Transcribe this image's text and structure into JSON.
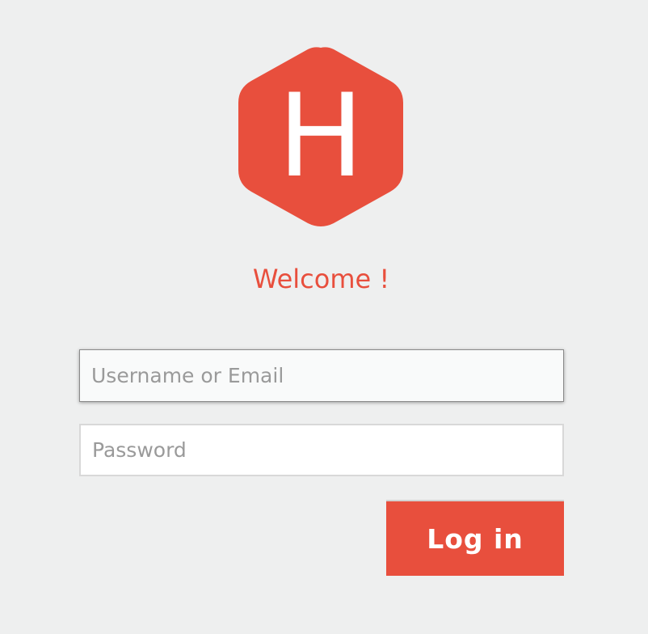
{
  "logo": {
    "letter": "H",
    "color": "#e84f3d"
  },
  "welcome_text": "Welcome !",
  "form": {
    "username_placeholder": "Username or Email",
    "username_value": "",
    "password_placeholder": "Password",
    "password_value": "",
    "login_label": "Log in"
  },
  "colors": {
    "accent": "#e84f3d",
    "background": "#eeefef"
  }
}
